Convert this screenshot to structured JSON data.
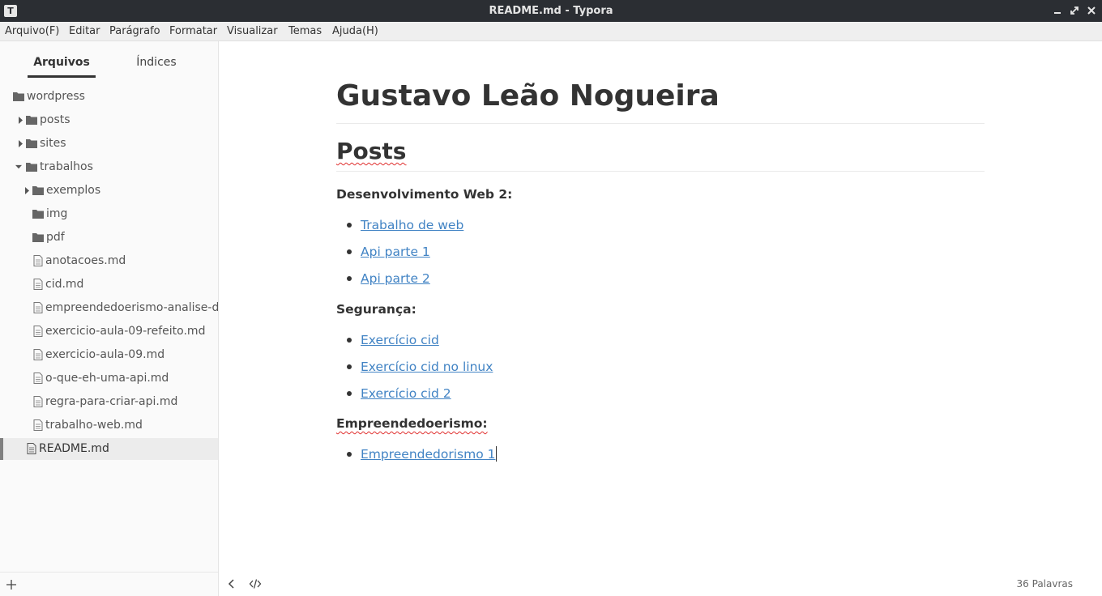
{
  "window": {
    "title": "README.md - Typora",
    "app_icon": "T",
    "controls": [
      "minimize-icon",
      "maximize-icon",
      "close-icon"
    ]
  },
  "menu": [
    "Arquivo(F)",
    "Editar",
    "Parágrafo",
    "Formatar",
    "Visualizar",
    "Temas",
    "Ajuda(H)"
  ],
  "sidebar": {
    "tabs": [
      "Arquivos",
      "Índices"
    ],
    "active_tab": "Arquivos",
    "tree": [
      {
        "label": "wordpress",
        "type": "folder",
        "expanded": true,
        "depth": 0
      },
      {
        "label": "posts",
        "type": "folder",
        "expanded": false,
        "depth": 1
      },
      {
        "label": "sites",
        "type": "folder",
        "expanded": false,
        "depth": 1
      },
      {
        "label": "trabalhos",
        "type": "folder",
        "expanded": true,
        "depth": 1
      },
      {
        "label": "exemplos",
        "type": "folder",
        "expanded": false,
        "depth": 2
      },
      {
        "label": "img",
        "type": "folder",
        "depth": 2
      },
      {
        "label": "pdf",
        "type": "folder",
        "depth": 2
      },
      {
        "label": "anotacoes.md",
        "type": "file",
        "depth": 2
      },
      {
        "label": "cid.md",
        "type": "file",
        "depth": 2
      },
      {
        "label": "empreendedoerismo-analise-de-m",
        "type": "file",
        "depth": 2
      },
      {
        "label": "exercicio-aula-09-refeito.md",
        "type": "file",
        "depth": 2
      },
      {
        "label": "exercicio-aula-09.md",
        "type": "file",
        "depth": 2
      },
      {
        "label": "o-que-eh-uma-api.md",
        "type": "file",
        "depth": 2
      },
      {
        "label": "regra-para-criar-api.md",
        "type": "file",
        "depth": 2
      },
      {
        "label": "trabalho-web.md",
        "type": "file",
        "depth": 2
      },
      {
        "label": "README.md",
        "type": "file",
        "depth": 1,
        "selected": true
      }
    ],
    "footer": {
      "add_icon": "plus-icon"
    }
  },
  "document": {
    "h1": "Gustavo Leão Nogueira",
    "h2": "Posts",
    "sections": [
      {
        "heading": "Desenvolvimento Web 2:",
        "links": [
          "Trabalho de web",
          "Api parte 1",
          "Api parte 2"
        ]
      },
      {
        "heading": "Segurança:",
        "links": [
          "Exercício cid",
          "Exercício cid no linux",
          "Exercício cid 2"
        ]
      },
      {
        "heading": "Empreendedoerismo:",
        "links": [
          "Empreendedorismo 1"
        ]
      }
    ]
  },
  "statusbar": {
    "toggle_sidebar_icon": "chevron-left-icon",
    "source_mode_icon": "code-icon",
    "word_count": "36 Palavras"
  },
  "colors": {
    "titlebar": "#2b2e33",
    "link": "#4183c4",
    "text": "#333333",
    "sidebar_bg": "#fafafa",
    "spellcheck": "#e0302f"
  }
}
